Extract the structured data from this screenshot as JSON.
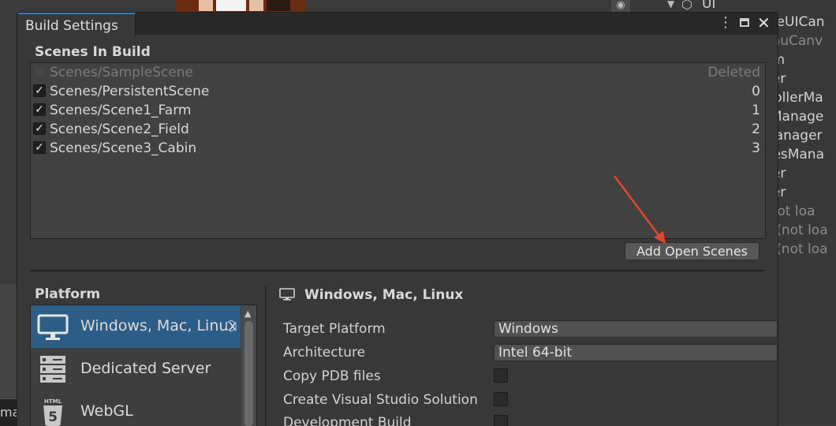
{
  "background": {
    "hierarchy": {
      "top_label": "UI",
      "rows": [
        {
          "text": "meUICan",
          "dim": false
        },
        {
          "text": "enuCanv",
          "dim": true
        },
        {
          "text": "em",
          "dim": false
        },
        {
          "text": "ger",
          "dim": false
        },
        {
          "text": "trollerMa",
          "dim": false
        },
        {
          "text": "sManage",
          "dim": false
        },
        {
          "text": "Manager",
          "dim": false
        },
        {
          "text": "tiesMana",
          "dim": false
        },
        {
          "text": "ger",
          "dim": false
        },
        {
          "text": "ger",
          "dim": false
        },
        {
          "text": "(not loa",
          "dim": true
        },
        {
          "text": "d (not loa",
          "dim": true
        },
        {
          "text": "n (not loa",
          "dim": true
        }
      ]
    },
    "bottom_left_text": "ma"
  },
  "window": {
    "title": "Build Settings",
    "icons": [
      "more-vertical-icon",
      "maximize-icon",
      "close-icon"
    ]
  },
  "scenes": {
    "label": "Scenes In Build",
    "items": [
      {
        "name": "Scenes/SampleScene",
        "index": "Deleted",
        "checked": false,
        "deleted": true
      },
      {
        "name": "Scenes/PersistentScene",
        "index": "0",
        "checked": true,
        "deleted": false
      },
      {
        "name": "Scenes/Scene1_Farm",
        "index": "1",
        "checked": true,
        "deleted": false
      },
      {
        "name": "Scenes/Scene2_Field",
        "index": "2",
        "checked": true,
        "deleted": false
      },
      {
        "name": "Scenes/Scene3_Cabin",
        "index": "3",
        "checked": true,
        "deleted": false
      }
    ],
    "add_button": "Add Open Scenes"
  },
  "platform": {
    "label": "Platform",
    "items": [
      {
        "name": "Windows, Mac, Linux",
        "icon": "monitor-icon",
        "selected": true
      },
      {
        "name": "Dedicated Server",
        "icon": "server-icon",
        "selected": false
      },
      {
        "name": "WebGL",
        "icon": "html5-icon",
        "selected": false
      }
    ]
  },
  "settings": {
    "title": "Windows, Mac, Linux",
    "target_platform": {
      "label": "Target Platform",
      "value": "Windows"
    },
    "architecture": {
      "label": "Architecture",
      "value": "Intel 64-bit"
    },
    "copy_pdb": {
      "label": "Copy PDB files",
      "checked": false
    },
    "create_vs_solution": {
      "label": "Create Visual Studio Solution",
      "checked": false
    },
    "development_build": {
      "label": "Development Build",
      "checked": false
    }
  },
  "annotation": {
    "color": "#e5452a"
  },
  "colors": {
    "selected": "#2c5d87",
    "accent": "#3a79bb"
  }
}
